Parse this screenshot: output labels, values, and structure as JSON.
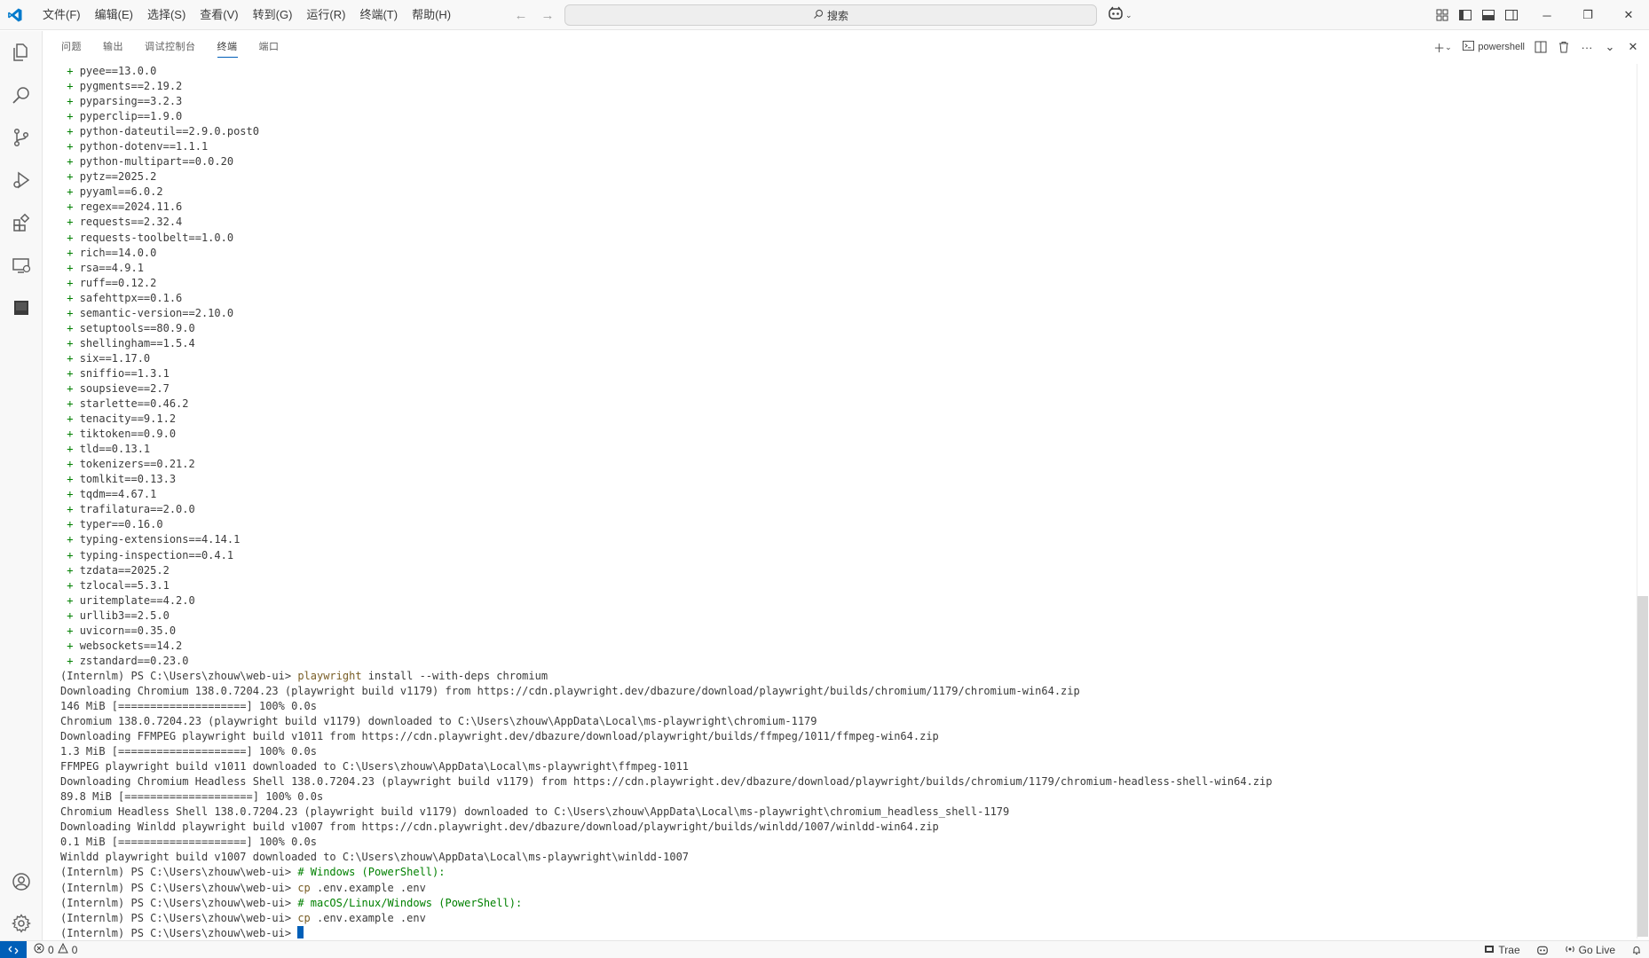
{
  "menubar": {
    "items": [
      "文件(F)",
      "编辑(E)",
      "选择(S)",
      "查看(V)",
      "转到(G)",
      "运行(R)",
      "终端(T)",
      "帮助(H)"
    ]
  },
  "search": {
    "label": "搜索"
  },
  "window_controls": {
    "minimize": "─",
    "restore": "❐",
    "close": "✕"
  },
  "panel": {
    "tabs": [
      "问题",
      "输出",
      "调试控制台",
      "终端",
      "端口"
    ],
    "active_tab": "终端",
    "terminal_name": "powershell"
  },
  "terminal": {
    "packages": [
      "pyee==13.0.0",
      "pygments==2.19.2",
      "pyparsing==3.2.3",
      "pyperclip==1.9.0",
      "python-dateutil==2.9.0.post0",
      "python-dotenv==1.1.1",
      "python-multipart==0.0.20",
      "pytz==2025.2",
      "pyyaml==6.0.2",
      "regex==2024.11.6",
      "requests==2.32.4",
      "requests-toolbelt==1.0.0",
      "rich==14.0.0",
      "rsa==4.9.1",
      "ruff==0.12.2",
      "safehttpx==0.1.6",
      "semantic-version==2.10.0",
      "setuptools==80.9.0",
      "shellingham==1.5.4",
      "six==1.17.0",
      "sniffio==1.3.1",
      "soupsieve==2.7",
      "starlette==0.46.2",
      "tenacity==9.1.2",
      "tiktoken==0.9.0",
      "tld==0.13.1",
      "tokenizers==0.21.2",
      "tomlkit==0.13.3",
      "tqdm==4.67.1",
      "trafilatura==2.0.0",
      "typer==0.16.0",
      "typing-extensions==4.14.1",
      "typing-inspection==0.4.1",
      "tzdata==2025.2",
      "tzlocal==5.3.1",
      "uritemplate==4.2.0",
      "urllib3==2.5.0",
      "uvicorn==0.35.0",
      "websockets==14.2",
      "zstandard==0.23.0"
    ],
    "prompt": "(Internlm) PS C:\\Users\\zhouw\\web-ui> ",
    "install_cmd": {
      "bin": "playwright",
      "args": " install --with-deps chromium"
    },
    "output": [
      "Downloading Chromium 138.0.7204.23 (playwright build v1179) from https://cdn.playwright.dev/dbazure/download/playwright/builds/chromium/1179/chromium-win64.zip",
      "146 MiB [====================] 100% 0.0s",
      "Chromium 138.0.7204.23 (playwright build v1179) downloaded to C:\\Users\\zhouw\\AppData\\Local\\ms-playwright\\chromium-1179",
      "Downloading FFMPEG playwright build v1011 from https://cdn.playwright.dev/dbazure/download/playwright/builds/ffmpeg/1011/ffmpeg-win64.zip",
      "1.3 MiB [====================] 100% 0.0s",
      "FFMPEG playwright build v1011 downloaded to C:\\Users\\zhouw\\AppData\\Local\\ms-playwright\\ffmpeg-1011",
      "Downloading Chromium Headless Shell 138.0.7204.23 (playwright build v1179) from https://cdn.playwright.dev/dbazure/download/playwright/builds/chromium/1179/chromium-headless-shell-win64.zip",
      "89.8 MiB [====================] 100% 0.0s",
      "Chromium Headless Shell 138.0.7204.23 (playwright build v1179) downloaded to C:\\Users\\zhouw\\AppData\\Local\\ms-playwright\\chromium_headless_shell-1179",
      "Downloading Winldd playwright build v1007 from https://cdn.playwright.dev/dbazure/download/playwright/builds/winldd/1007/winldd-win64.zip",
      "0.1 MiB [====================] 100% 0.0s",
      "Winldd playwright build v1007 downloaded to C:\\Users\\zhouw\\AppData\\Local\\ms-playwright\\winldd-1007"
    ],
    "comment1": "# Windows (PowerShell):",
    "cp_cmd": {
      "bin": "cp",
      "args": " .env.example .env"
    },
    "comment2": "# macOS/Linux/Windows (PowerShell):"
  },
  "statusbar": {
    "errors": "0",
    "warnings": "0",
    "trae": "Trae",
    "golive": "Go Live"
  },
  "colors": {
    "accent": "#005fb8",
    "package_plus": "#008000",
    "command": "#795e26",
    "comment": "#008000"
  }
}
